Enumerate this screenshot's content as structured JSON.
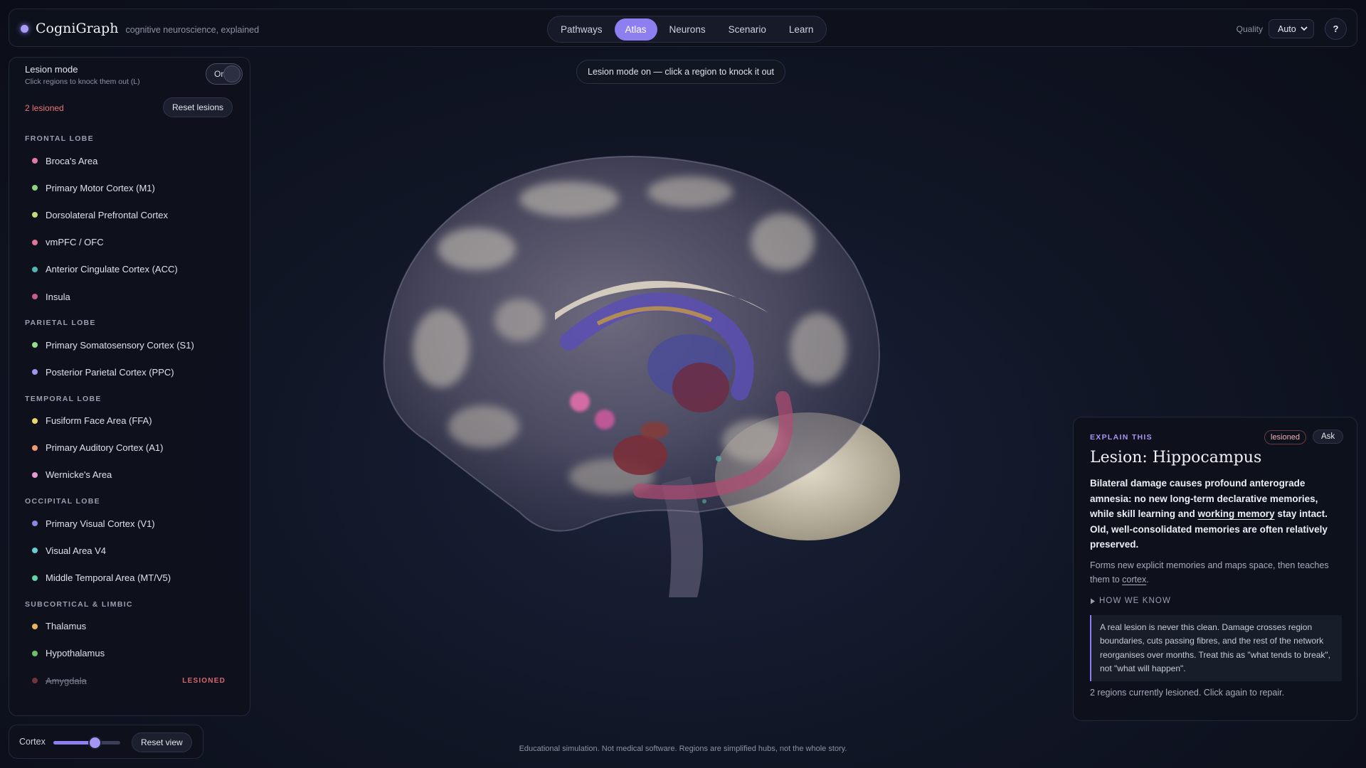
{
  "header": {
    "brand_name": "CogniGraph",
    "tagline": "cognitive neuroscience, explained",
    "tabs": [
      {
        "label": "Pathways",
        "active": false
      },
      {
        "label": "Atlas",
        "active": true
      },
      {
        "label": "Neurons",
        "active": false
      },
      {
        "label": "Scenario",
        "active": false
      },
      {
        "label": "Learn",
        "active": false
      }
    ],
    "quality_label": "Quality",
    "quality_value": "Auto",
    "help_label": "?"
  },
  "sidebar": {
    "lesion_mode_title": "Lesion mode",
    "lesion_mode_hint": "Click regions to knock them out (L)",
    "toggle_label": "On",
    "lesioned_count": "2 lesioned",
    "reset_lesions_label": "Reset lesions",
    "lesion_badge": "LESIONED",
    "groups": [
      {
        "title": "FRONTAL LOBE",
        "items": [
          {
            "label": "Broca's Area",
            "color": "#e27aa4"
          },
          {
            "label": "Primary Motor Cortex (M1)",
            "color": "#8cd47e"
          },
          {
            "label": "Dorsolateral Prefrontal Cortex",
            "color": "#c6d97c"
          },
          {
            "label": "vmPFC / OFC",
            "color": "#e2739a"
          },
          {
            "label": "Anterior Cingulate Cortex (ACC)",
            "color": "#4fb6b0"
          },
          {
            "label": "Insula",
            "color": "#c65b8c"
          }
        ]
      },
      {
        "title": "PARIETAL LOBE",
        "items": [
          {
            "label": "Primary Somatosensory Cortex (S1)",
            "color": "#96dc8a"
          },
          {
            "label": "Posterior Parietal Cortex (PPC)",
            "color": "#9f94f0"
          }
        ]
      },
      {
        "title": "TEMPORAL LOBE",
        "items": [
          {
            "label": "Fusiform Face Area (FFA)",
            "color": "#e6d86a"
          },
          {
            "label": "Primary Auditory Cortex (A1)",
            "color": "#ef9a70"
          },
          {
            "label": "Wernicke's Area",
            "color": "#e79ad0"
          }
        ]
      },
      {
        "title": "OCCIPITAL LOBE",
        "items": [
          {
            "label": "Primary Visual Cortex (V1)",
            "color": "#8a88e6"
          },
          {
            "label": "Visual Area V4",
            "color": "#66cfd4"
          },
          {
            "label": "Middle Temporal Area (MT/V5)",
            "color": "#5fd6a8"
          }
        ]
      },
      {
        "title": "SUBCORTICAL & LIMBIC",
        "items": [
          {
            "label": "Thalamus",
            "color": "#e8b65a"
          },
          {
            "label": "Hypothalamus",
            "color": "#6fbf6a"
          },
          {
            "label": "Amygdala",
            "color": "#c7515a",
            "lesioned": true
          }
        ]
      }
    ]
  },
  "cortex": {
    "label": "Cortex",
    "level": 0.62,
    "reset_view_label": "Reset view"
  },
  "center": {
    "mode_pill": "Lesion mode on — click a region to knock it out",
    "footer_note": "Educational simulation. Not medical software. Regions are simplified hubs, not the whole story."
  },
  "explain": {
    "kicker": "EXPLAIN THIS",
    "badge": "lesioned",
    "ask_label": "Ask",
    "title": "Lesion: Hippocampus",
    "summary_1": "Bilateral damage causes profound anterograde amnesia: no new long-term declarative memories, while skill learning and ",
    "summary_link": "working memory",
    "summary_2": " stay intact. Old, well-consolidated memories are often relatively preserved.",
    "body_1": "Forms new explicit memories and maps space, then teaches them to ",
    "body_link": "cortex",
    "body_2": ".",
    "how_label": "HOW WE KNOW",
    "how_text": "A real lesion is never this clean. Damage crosses region boundaries, cuts passing fibres, and the rest of the network reorganises over months. Treat this as \"what tends to break\", not \"what will happen\".",
    "status": "2 regions currently lesioned. Click again to repair."
  },
  "colors": {
    "accent": "#8e7ff0",
    "lesion_red": "#e8757a",
    "panel": "#0e111c"
  }
}
